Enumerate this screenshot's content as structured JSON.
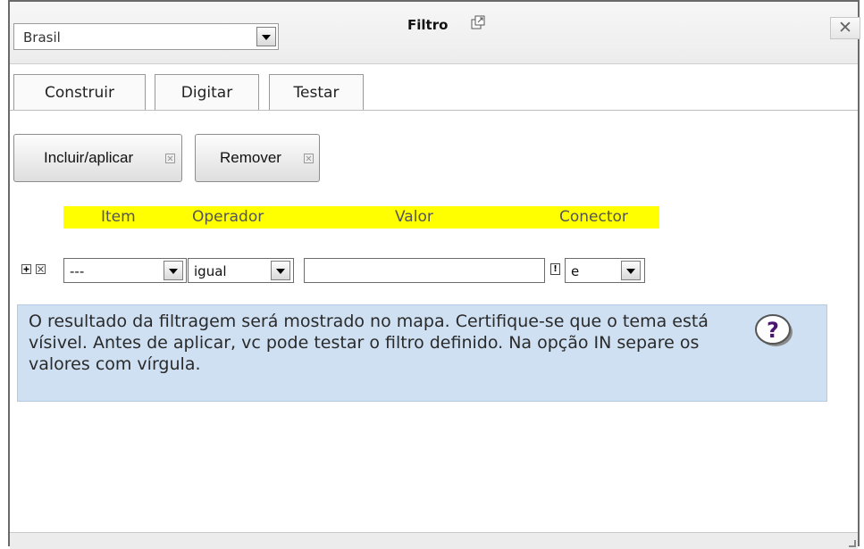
{
  "header": {
    "context_select_value": "Brasil",
    "title": "Filtro",
    "close_label": "✕"
  },
  "tabs": [
    {
      "label": "Construir"
    },
    {
      "label": "Digitar"
    },
    {
      "label": "Testar"
    }
  ],
  "actions": {
    "include_label": "Incluir/aplicar",
    "remove_label": "Remover"
  },
  "columns": {
    "item": "Item",
    "operator": "Operador",
    "value": "Valor",
    "connector": "Conector"
  },
  "filter_row": {
    "item_value": "---",
    "operator_value": "igual",
    "value_text": "",
    "connector_value": "e"
  },
  "info": {
    "text": "O resultado da filtragem será mostrado no mapa. Certifique-se que o tema está vísivel. Antes de aplicar, vc pode testar o filtro definido. Na opção IN separe os valores com vírgula.",
    "help_symbol": "?"
  },
  "colors": {
    "header_highlight": "#ffff00",
    "info_background": "#cfe0f3"
  }
}
